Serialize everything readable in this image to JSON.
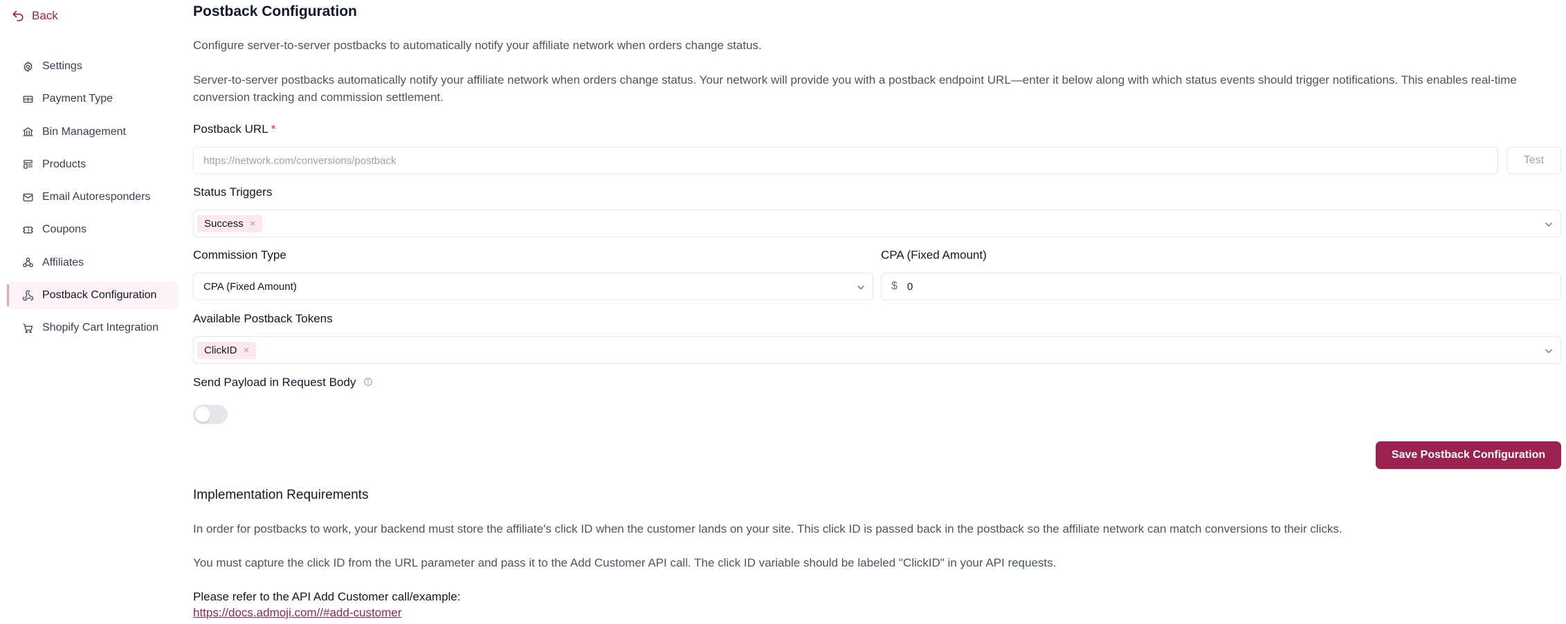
{
  "nav": {
    "back_label": "Back",
    "items": [
      {
        "label": "Settings",
        "icon": "gear-icon"
      },
      {
        "label": "Payment Type",
        "icon": "payment-icon"
      },
      {
        "label": "Bin Management",
        "icon": "bank-icon"
      },
      {
        "label": "Products",
        "icon": "products-icon"
      },
      {
        "label": "Email Autoresponders",
        "icon": "mail-icon"
      },
      {
        "label": "Coupons",
        "icon": "ticket-icon"
      },
      {
        "label": "Affiliates",
        "icon": "affiliates-icon"
      },
      {
        "label": "Postback Configuration",
        "icon": "webhook-icon",
        "active": true
      },
      {
        "label": "Shopify Cart Integration",
        "icon": "cart-icon"
      }
    ]
  },
  "page": {
    "title": "Postback Configuration",
    "intro": "Configure server-to-server postbacks to automatically notify your affiliate network when orders change status.",
    "description": "Server-to-server postbacks automatically notify your affiliate network when orders change status. Your network will provide you with a postback endpoint URL—enter it below along with which status events should trigger notifications. This enables real-time conversion tracking and commission settlement."
  },
  "form": {
    "postback_url": {
      "label": "Postback URL",
      "required_mark": "*",
      "value": "",
      "placeholder": "https://network.com/conversions/postback",
      "test_label": "Test"
    },
    "status_triggers": {
      "label": "Status Triggers",
      "chips": [
        "Success"
      ]
    },
    "commission_type": {
      "label": "Commission Type",
      "value": "CPA (Fixed Amount)"
    },
    "cpa_amount": {
      "label": "CPA (Fixed Amount)",
      "currency": "$",
      "value": "0"
    },
    "postback_tokens": {
      "label": "Available Postback Tokens",
      "chips": [
        "ClickID"
      ]
    },
    "send_payload": {
      "label": "Send Payload in Request Body",
      "enabled": false
    },
    "save_label": "Save Postback Configuration"
  },
  "implementation": {
    "title": "Implementation Requirements",
    "p1": "In order for postbacks to work, your backend must store the affiliate's click ID when the customer lands on your site. This click ID is passed back in the postback so the affiliate network can match conversions to their clicks.",
    "p2": "You must capture the click ID from the URL parameter and pass it to the Add Customer API call. The click ID variable should be labeled \"ClickID\" in your API requests.",
    "p3": "Please refer to the API Add Customer call/example:",
    "link": "https://docs.admoji.com//#add-customer"
  },
  "colors": {
    "accent": "#9b2150",
    "chip_bg": "#fbe9ef",
    "active_nav_bg": "#fdf2f5"
  }
}
